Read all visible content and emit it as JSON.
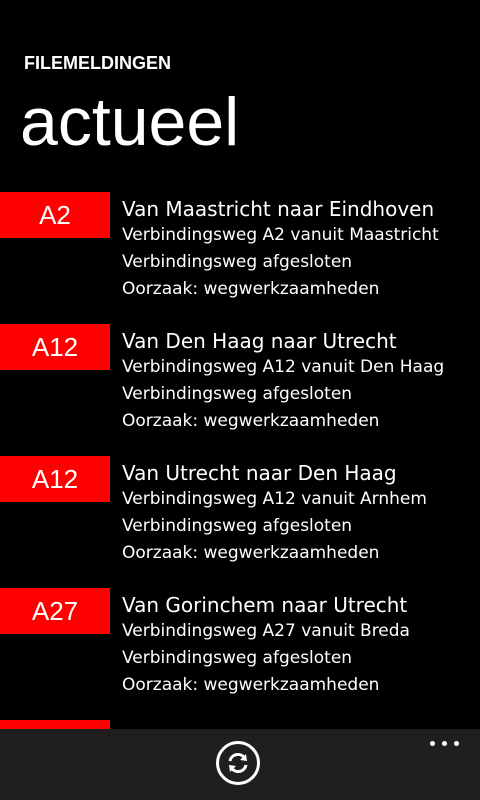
{
  "header": {
    "app_title": "FILEMELDINGEN",
    "page_title": "actueel"
  },
  "items": [
    {
      "road": "A2",
      "heading": "Van Maastricht naar Eindhoven",
      "line1": "Verbindingsweg A2 vanuit Maastricht",
      "line2": "Verbindingsweg afgesloten",
      "line3": "Oorzaak: wegwerkzaamheden"
    },
    {
      "road": "A12",
      "heading": "Van Den Haag naar Utrecht",
      "line1": "Verbindingsweg A12 vanuit Den Haag",
      "line2": "Verbindingsweg afgesloten",
      "line3": "Oorzaak: wegwerkzaamheden"
    },
    {
      "road": "A12",
      "heading": "Van Utrecht naar Den Haag",
      "line1": "Verbindingsweg A12 vanuit Arnhem",
      "line2": "Verbindingsweg afgesloten",
      "line3": "Oorzaak: wegwerkzaamheden"
    },
    {
      "road": "A27",
      "heading": "Van Gorinchem naar Utrecht",
      "line1": "Verbindingsweg A27 vanuit Breda",
      "line2": "Verbindingsweg afgesloten",
      "line3": "Oorzaak: wegwerkzaamheden"
    }
  ],
  "app_bar": {
    "refresh_icon": "refresh-icon",
    "more_icon": "more-options-icon"
  },
  "colors": {
    "accent": "#ff0000",
    "background": "#000000",
    "app_bar": "#1f1f1f"
  }
}
